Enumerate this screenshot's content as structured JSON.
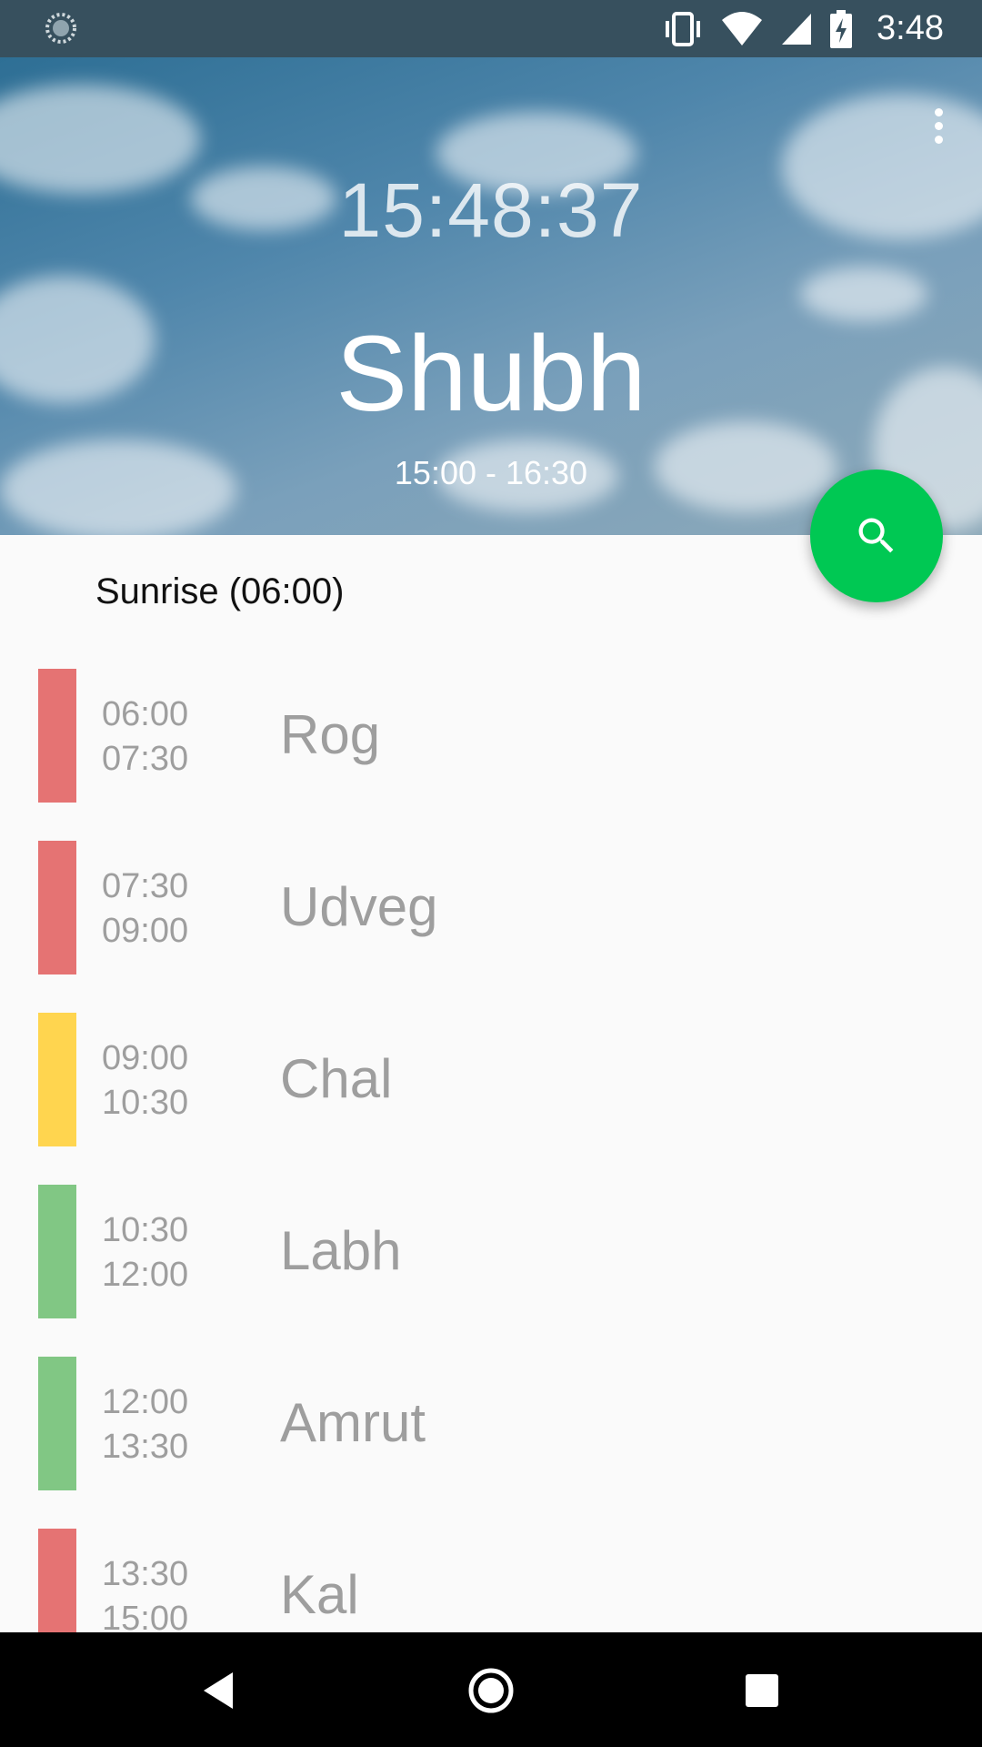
{
  "status_bar": {
    "time": "3:48",
    "icons": [
      "loading-icon",
      "vibrate-icon",
      "wifi-icon",
      "signal-icon",
      "battery-charging-icon"
    ]
  },
  "header": {
    "clock": "15:48:37",
    "current_name": "Shubh",
    "current_range": "15:00 - 16:30",
    "menu_icon": "more-vert-icon"
  },
  "fab": {
    "icon": "search-icon",
    "color": "#00c853"
  },
  "sunrise_label": "Sunrise (06:00)",
  "rows": [
    {
      "start": "06:00",
      "end": "07:30",
      "name": "Rog",
      "color": "#e57373"
    },
    {
      "start": "07:30",
      "end": "09:00",
      "name": "Udveg",
      "color": "#e57373"
    },
    {
      "start": "09:00",
      "end": "10:30",
      "name": "Chal",
      "color": "#ffd54f"
    },
    {
      "start": "10:30",
      "end": "12:00",
      "name": "Labh",
      "color": "#81c784"
    },
    {
      "start": "12:00",
      "end": "13:30",
      "name": "Amrut",
      "color": "#81c784"
    },
    {
      "start": "13:30",
      "end": "15:00",
      "name": "Kal",
      "color": "#e57373"
    }
  ],
  "nav": {
    "back": "back-icon",
    "home": "home-icon",
    "recents": "recents-icon"
  }
}
